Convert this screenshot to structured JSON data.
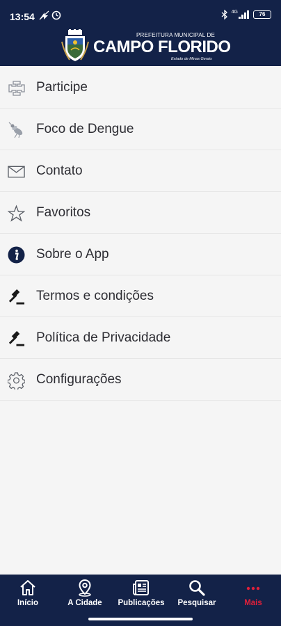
{
  "status_bar": {
    "time": "13:54",
    "signal_label": "4G",
    "battery": "76"
  },
  "logo": {
    "top": "PREFEITURA MUNICIPAL DE",
    "main": "CAMPO FLORIDO",
    "sub": "Estado de Minas Gerais"
  },
  "menu": {
    "items": [
      {
        "label": "Participe",
        "icon": "participate-icon"
      },
      {
        "label": "Foco de Dengue",
        "icon": "mosquito-icon"
      },
      {
        "label": "Contato",
        "icon": "envelope-icon"
      },
      {
        "label": "Favoritos",
        "icon": "star-icon"
      },
      {
        "label": "Sobre o App",
        "icon": "info-icon"
      },
      {
        "label": "Termos e condições",
        "icon": "gavel-icon"
      },
      {
        "label": "Política de Privacidade",
        "icon": "gavel-icon"
      },
      {
        "label": "Configurações",
        "icon": "gear-icon"
      }
    ]
  },
  "bottom_nav": {
    "items": [
      {
        "label": "Início",
        "icon": "home-icon"
      },
      {
        "label": "A Cidade",
        "icon": "location-pin-icon"
      },
      {
        "label": "Publicações",
        "icon": "newspaper-icon"
      },
      {
        "label": "Pesquisar",
        "icon": "search-icon"
      },
      {
        "label": "Mais",
        "icon": "more-dots-icon"
      }
    ],
    "active_index": 4,
    "active_color": "#e0203a"
  },
  "colors": {
    "header_bg": "#132248",
    "page_bg": "#f5f5f5",
    "text": "#2d2d33"
  }
}
